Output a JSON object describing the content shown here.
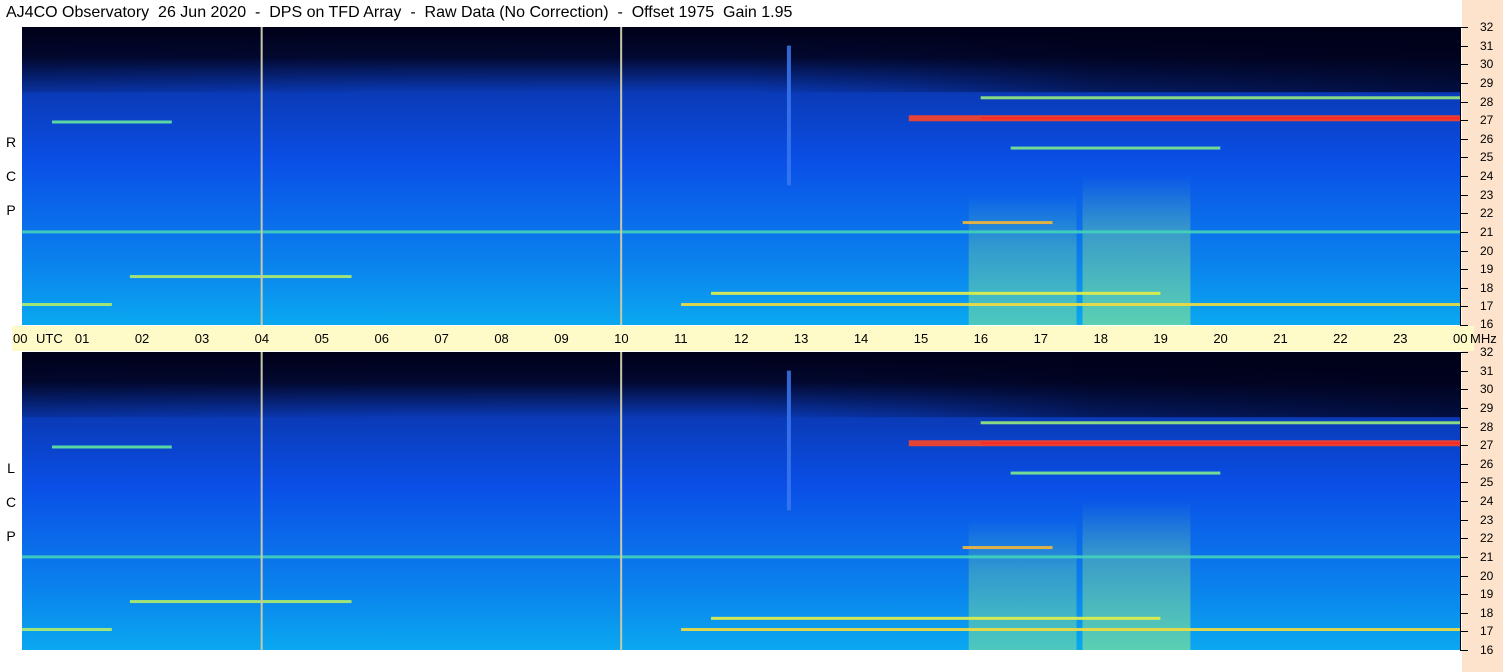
{
  "title": "AJ4CO Observatory  26 Jun 2020  -  DPS on TFD Array  -  Raw Data (No Correction)  -  Offset 1975  Gain 1.95",
  "chart_data": {
    "type": "heatmap",
    "panels": [
      {
        "name": "RCP",
        "label_letters": [
          "R",
          "C",
          "P"
        ]
      },
      {
        "name": "LCP",
        "label_letters": [
          "L",
          "C",
          "P"
        ]
      }
    ],
    "x_ticks": [
      "00",
      "01",
      "02",
      "03",
      "04",
      "05",
      "06",
      "07",
      "08",
      "09",
      "10",
      "11",
      "12",
      "13",
      "14",
      "15",
      "16",
      "17",
      "18",
      "19",
      "20",
      "21",
      "22",
      "23",
      "00"
    ],
    "x_unit": "UTC",
    "y_ticks": [
      "32",
      "31",
      "30",
      "29",
      "28",
      "27",
      "26",
      "25",
      "24",
      "23",
      "22",
      "21",
      "20",
      "19",
      "18",
      "17",
      "16"
    ],
    "y_unit": "MHz",
    "xlim": [
      0,
      24
    ],
    "ylim": [
      16,
      32
    ],
    "marker_lines_utc": [
      4,
      10
    ],
    "colormap": [
      "#000018",
      "#0a2fa0",
      "#0a50e8",
      "#0aa8f0",
      "#60e8a0",
      "#f0f040",
      "#ff2020"
    ],
    "features": [
      {
        "desc": "strong band",
        "freq_mhz": 27.1,
        "utc_start": 14.8,
        "utc_end": 24,
        "intensity": 0.95
      },
      {
        "desc": "band",
        "freq_mhz": 28.2,
        "utc_start": 16,
        "utc_end": 24,
        "intensity": 0.55
      },
      {
        "desc": "band",
        "freq_mhz": 25.5,
        "utc_start": 16.5,
        "utc_end": 20,
        "intensity": 0.5
      },
      {
        "desc": "band",
        "freq_mhz": 21.5,
        "utc_start": 15.7,
        "utc_end": 17.2,
        "intensity": 0.8
      },
      {
        "desc": "band",
        "freq_mhz": 21.0,
        "utc_start": 0,
        "utc_end": 24,
        "intensity": 0.35
      },
      {
        "desc": "band",
        "freq_mhz": 17.1,
        "utc_start": 11,
        "utc_end": 24,
        "intensity": 0.75
      },
      {
        "desc": "band",
        "freq_mhz": 17.7,
        "utc_start": 11.5,
        "utc_end": 19,
        "intensity": 0.7
      },
      {
        "desc": "band",
        "freq_mhz": 18.6,
        "utc_start": 1.8,
        "utc_end": 5.5,
        "intensity": 0.6
      },
      {
        "desc": "band",
        "freq_mhz": 17.1,
        "utc_start": 0,
        "utc_end": 1.5,
        "intensity": 0.6
      },
      {
        "desc": "band",
        "freq_mhz": 26.9,
        "utc_start": 0.5,
        "utc_end": 2.5,
        "intensity": 0.45
      },
      {
        "desc": "glow",
        "utc_start": 15.8,
        "utc_end": 17.6,
        "freq_low": 16,
        "freq_high": 23,
        "intensity": 0.45
      },
      {
        "desc": "glow",
        "utc_start": 17.7,
        "utc_end": 19.5,
        "freq_low": 16,
        "freq_high": 24,
        "intensity": 0.55
      },
      {
        "desc": "spike",
        "utc": 12.8,
        "freq_low": 23.5,
        "freq_high": 31,
        "intensity": 0.3
      }
    ]
  }
}
